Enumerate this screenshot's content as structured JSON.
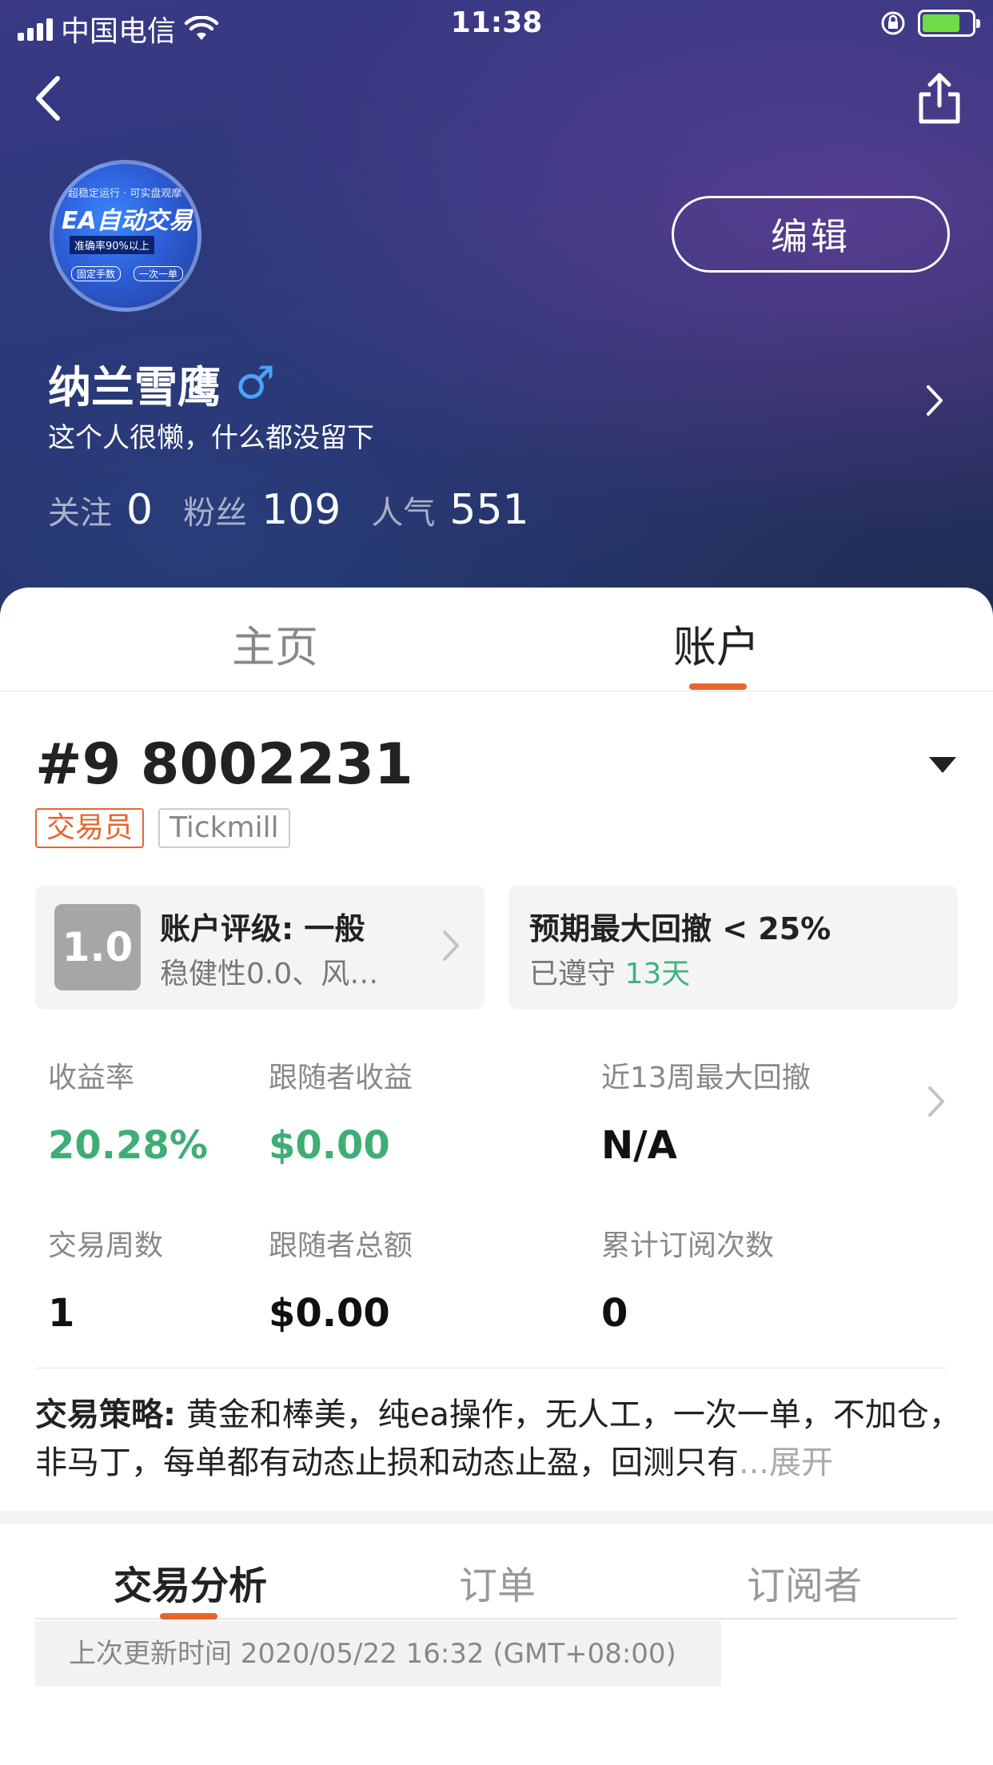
{
  "status_bar": {
    "carrier": "中国电信",
    "time": "11:38"
  },
  "header": {
    "edit_label": "编辑",
    "avatar_text": {
      "line1": "超稳定运行 · 可实盘观摩",
      "line2": "EA自动交易",
      "line3": "准确率90%以上",
      "tag1": "固定手数",
      "tag2": "一次一单"
    },
    "username": "纳兰雪鹰",
    "gender_symbol": "♂",
    "bio": "这个人很懒，什么都没留下",
    "stats": {
      "following_label": "关注",
      "following_value": "0",
      "fans_label": "粉丝",
      "fans_value": "109",
      "popularity_label": "人气",
      "popularity_value": "551"
    }
  },
  "top_tabs": {
    "home": "主页",
    "account": "账户",
    "active": "account"
  },
  "account": {
    "number": "#9 8002231",
    "tags": {
      "role": "交易员",
      "broker": "Tickmill"
    },
    "rating": {
      "score": "1.0",
      "title": "账户评级: 一般",
      "detail": "稳健性0.0、风…"
    },
    "drawdown": {
      "title": "预期最大回撤 < 25%",
      "kept_label": "已遵守",
      "kept_days": "13天"
    },
    "metrics": {
      "return_label": "收益率",
      "return_value": "20.28%",
      "follower_profit_label": "跟随者收益",
      "follower_profit_value": "$0.00",
      "max_drawdown_label": "近13周最大回撤",
      "max_drawdown_value": "N/A",
      "weeks_label": "交易周数",
      "weeks_value": "1",
      "follower_total_label": "跟随者总额",
      "follower_total_value": "$0.00",
      "subscriptions_label": "累计订阅次数",
      "subscriptions_value": "0"
    },
    "strategy": {
      "label": "交易策略:",
      "text": "黄金和棒美，纯ea操作，无人工，一次一单，不加仓，非马丁，每单都有动态止损和动态止盈，回测只有",
      "ellipsis": "...",
      "expand": "展开"
    }
  },
  "bottom_tabs": {
    "analysis": "交易分析",
    "orders": "订单",
    "subscribers": "订阅者",
    "active": "analysis"
  },
  "last_update": "上次更新时间 2020/05/22 16:32 (GMT+08:00)",
  "colors": {
    "accent": "#e8642e",
    "positive": "#3fae76",
    "gender": "#4aa4ff"
  }
}
